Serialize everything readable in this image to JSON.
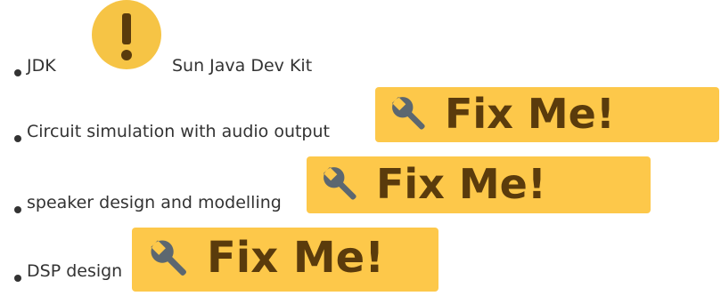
{
  "items": [
    {
      "prefix": "JDK",
      "text": "Sun Java Dev Kit",
      "icon": "warning-icon"
    },
    {
      "text": "Circuit simulation with audio output",
      "badge": "Fix Me!"
    },
    {
      "text": "speaker design and modelling",
      "badge": "Fix Me!"
    },
    {
      "text": "DSP design",
      "badge": "Fix Me!"
    }
  ],
  "colors": {
    "text": "#333333",
    "badge_bg": "#fdc84a",
    "badge_text": "#5a3b0c",
    "wrench": "#5c6770",
    "warning": "#f6c445",
    "warning_mark": "#5a3b0c"
  }
}
